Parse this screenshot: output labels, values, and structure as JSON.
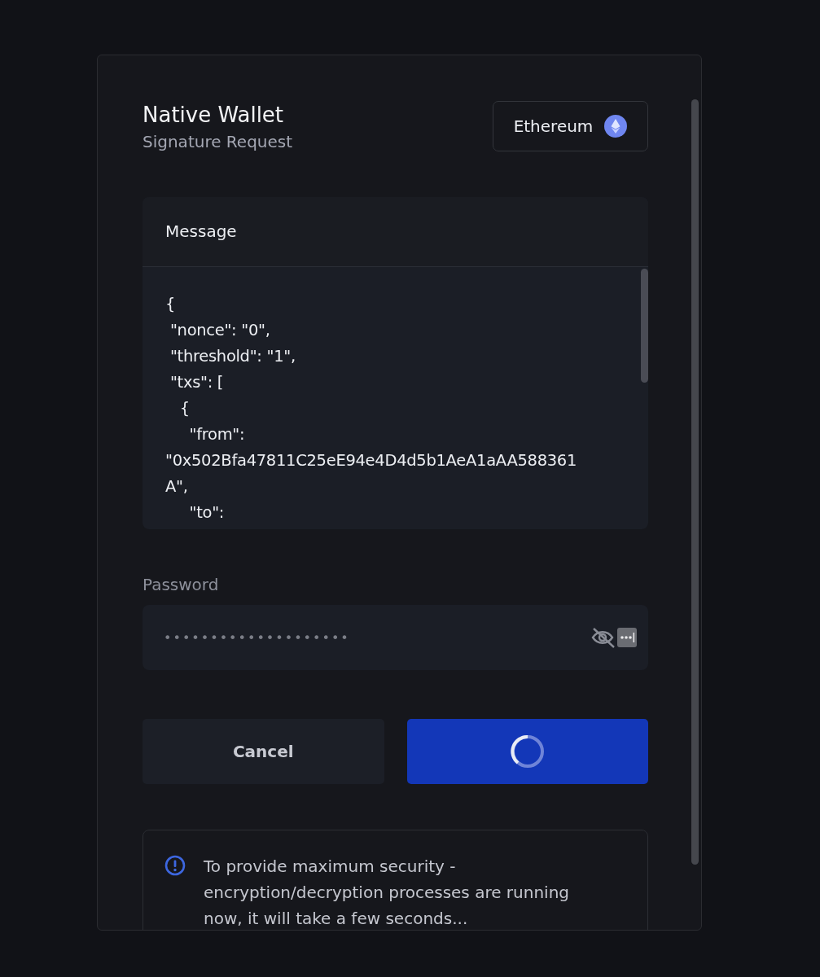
{
  "header": {
    "title": "Native Wallet",
    "subtitle": "Signature Request",
    "network": "Ethereum"
  },
  "message": {
    "heading": "Message",
    "lines": [
      "{",
      " \"nonce\": \"0\",",
      " \"threshold\": \"1\",",
      " \"txs\": [",
      "   {",
      "     \"from\":",
      "\"0x502Bfa47811C25eE94e4D4d5b1AeA1aAA588361",
      "A\",",
      "     \"to\":"
    ]
  },
  "password": {
    "label": "Password",
    "value": "••••••••••••••••••••"
  },
  "buttons": [
    {
      "kind": "secondary",
      "label": "Cancel"
    },
    {
      "kind": "loading"
    }
  ],
  "notice": "To provide maximum security - encryption/decryption processes are running now, it will take a few seconds..."
}
